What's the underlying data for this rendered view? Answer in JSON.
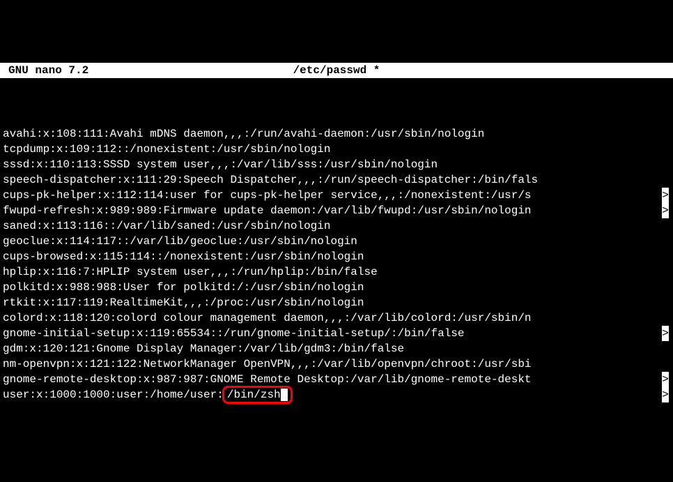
{
  "titlebar": {
    "app": "GNU nano 7.2",
    "file": "/etc/passwd *"
  },
  "editor": {
    "lines": [
      {
        "text": "avahi:x:108:111:Avahi mDNS daemon,,,:/run/avahi-daemon:/usr/sbin/nologin",
        "truncated": false
      },
      {
        "text": "tcpdump:x:109:112::/nonexistent:/usr/sbin/nologin",
        "truncated": false
      },
      {
        "text": "sssd:x:110:113:SSSD system user,,,:/var/lib/sss:/usr/sbin/nologin",
        "truncated": false
      },
      {
        "text": "speech-dispatcher:x:111:29:Speech Dispatcher,,,:/run/speech-dispatcher:/bin/fals",
        "truncated": true
      },
      {
        "text": "cups-pk-helper:x:112:114:user for cups-pk-helper service,,,:/nonexistent:/usr/s",
        "truncated": true
      },
      {
        "text": "fwupd-refresh:x:989:989:Firmware update daemon:/var/lib/fwupd:/usr/sbin/nologin",
        "truncated": false
      },
      {
        "text": "saned:x:113:116::/var/lib/saned:/usr/sbin/nologin",
        "truncated": false
      },
      {
        "text": "geoclue:x:114:117::/var/lib/geoclue:/usr/sbin/nologin",
        "truncated": false
      },
      {
        "text": "cups-browsed:x:115:114::/nonexistent:/usr/sbin/nologin",
        "truncated": false
      },
      {
        "text": "hplip:x:116:7:HPLIP system user,,,:/run/hplip:/bin/false",
        "truncated": false
      },
      {
        "text": "polkitd:x:988:988:User for polkitd:/:/usr/sbin/nologin",
        "truncated": false
      },
      {
        "text": "rtkit:x:117:119:RealtimeKit,,,:/proc:/usr/sbin/nologin",
        "truncated": false
      },
      {
        "text": "colord:x:118:120:colord colour management daemon,,,:/var/lib/colord:/usr/sbin/n",
        "truncated": true
      },
      {
        "text": "gnome-initial-setup:x:119:65534::/run/gnome-initial-setup/:/bin/false",
        "truncated": false
      },
      {
        "text": "gdm:x:120:121:Gnome Display Manager:/var/lib/gdm3:/bin/false",
        "truncated": false
      },
      {
        "text": "nm-openvpn:x:121:122:NetworkManager OpenVPN,,,:/var/lib/openvpn/chroot:/usr/sbi",
        "truncated": true
      },
      {
        "text": "gnome-remote-desktop:x:987:987:GNOME Remote Desktop:/var/lib/gnome-remote-deskt",
        "truncated": true
      }
    ],
    "last_line": {
      "prefix": "user:x:1000:1000:user:/home/user:",
      "highlighted": "/bin/zsh"
    },
    "truncation_marker": ">"
  }
}
